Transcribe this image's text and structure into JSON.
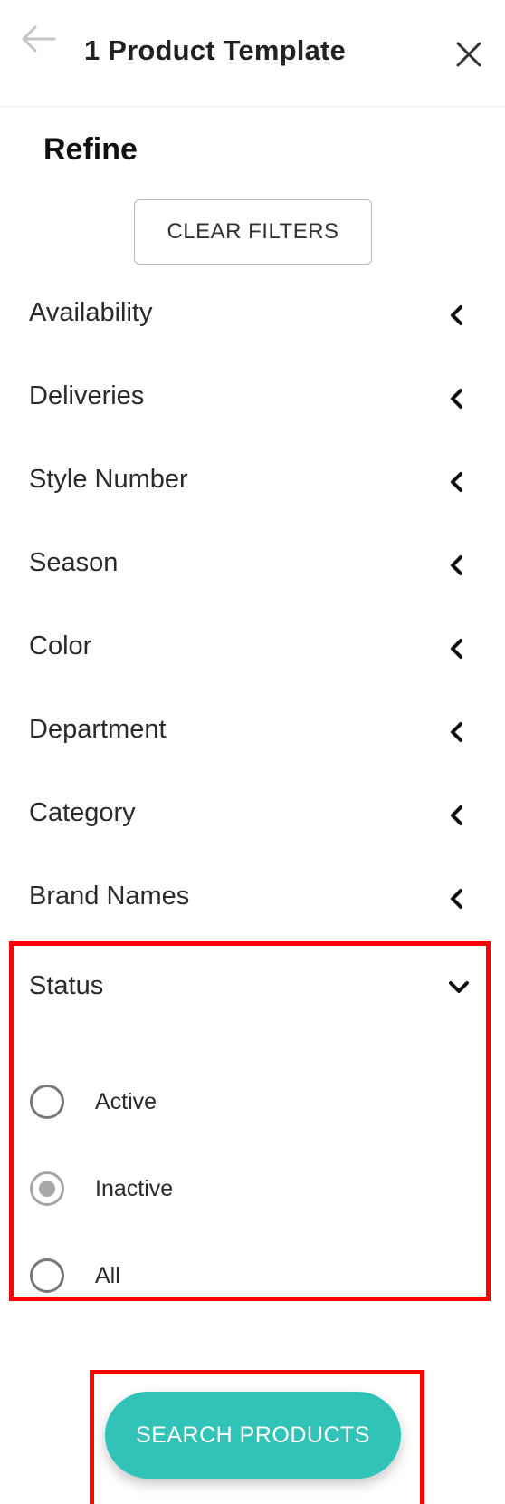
{
  "header": {
    "title": "1 Product Template",
    "back_icon": "arrow-left-icon",
    "close_icon": "close-icon"
  },
  "refine": {
    "title": "Refine",
    "clear_filters_label": "CLEAR FILTERS"
  },
  "filters": [
    {
      "label": "Availability",
      "expanded": false
    },
    {
      "label": "Deliveries",
      "expanded": false
    },
    {
      "label": "Style Number",
      "expanded": false
    },
    {
      "label": "Season",
      "expanded": false
    },
    {
      "label": "Color",
      "expanded": false
    },
    {
      "label": "Department",
      "expanded": false
    },
    {
      "label": "Category",
      "expanded": false
    },
    {
      "label": "Brand Names",
      "expanded": false
    }
  ],
  "status": {
    "label": "Status",
    "expanded": true,
    "options": [
      {
        "label": "Active",
        "selected": false
      },
      {
        "label": "Inactive",
        "selected": true
      },
      {
        "label": "All",
        "selected": false
      }
    ]
  },
  "search_button_label": "SEARCH PRODUCTS",
  "colors": {
    "accent": "#31c3b7",
    "highlight": "#ff0000"
  }
}
